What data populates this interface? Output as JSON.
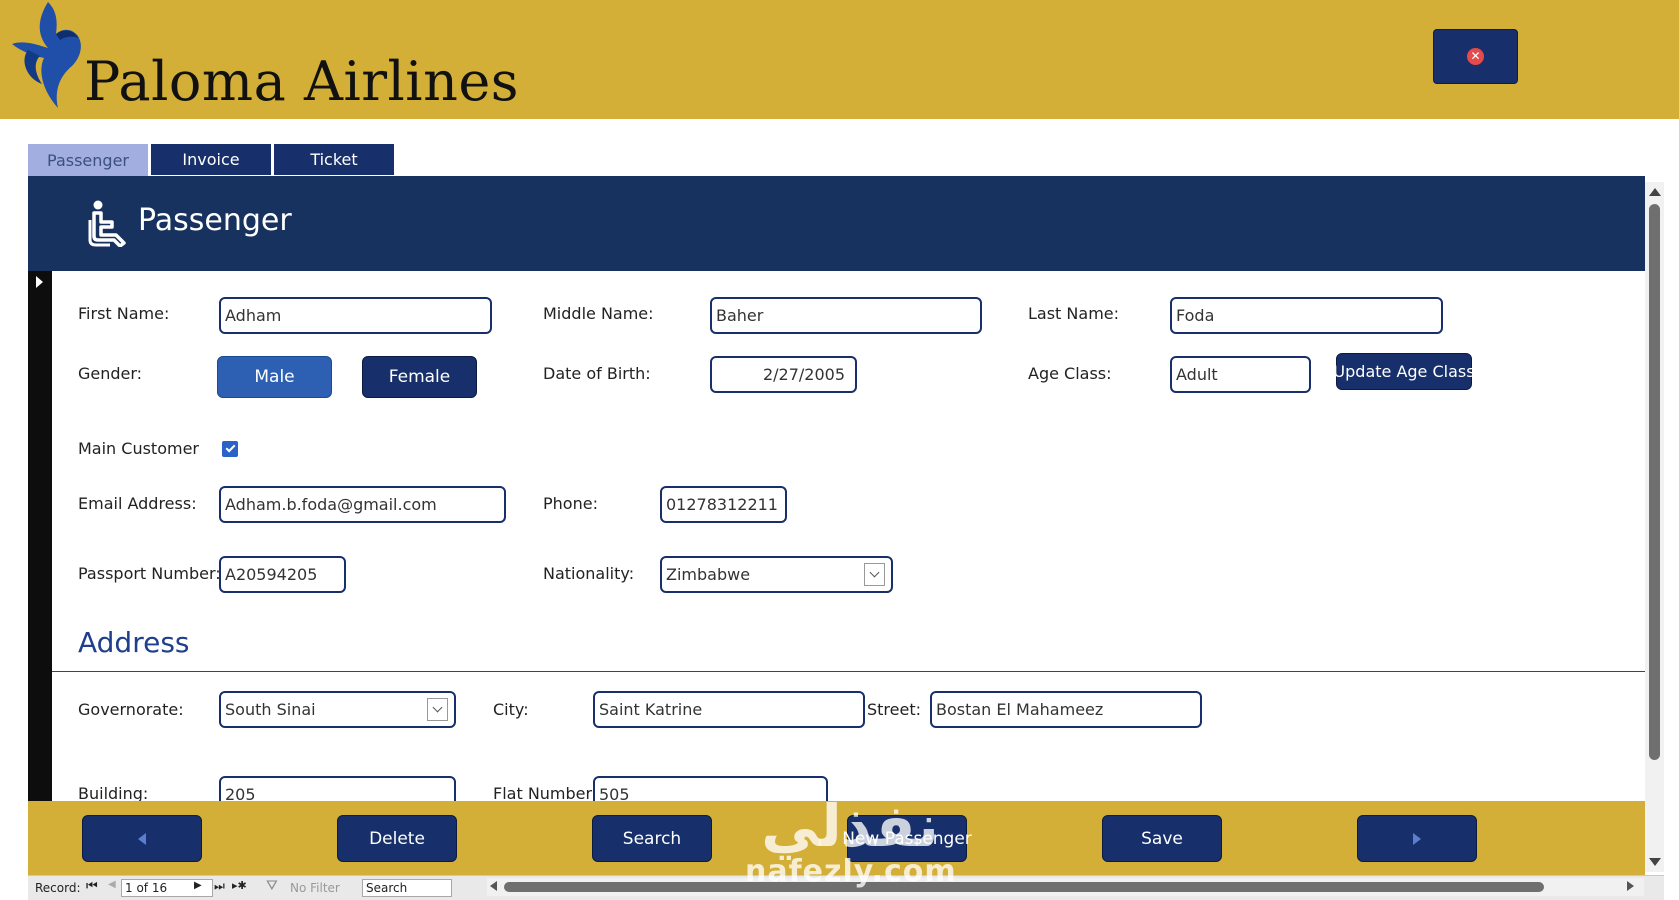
{
  "header": {
    "brand": "Paloma Airlines",
    "close_icon": "close-icon"
  },
  "tabs": [
    {
      "label": "Passenger",
      "active": true
    },
    {
      "label": "Invoice",
      "active": false
    },
    {
      "label": "Ticket",
      "active": false
    }
  ],
  "form": {
    "title": "Passenger",
    "title_icon": "seated-person-icon",
    "labels": {
      "first_name": "First Name:",
      "middle_name": "Middle Name:",
      "last_name": "Last Name:",
      "gender": "Gender:",
      "dob": "Date of Birth:",
      "age_class": "Age Class:",
      "main_customer": "Main Customer",
      "email": "Email Address:",
      "phone": "Phone:",
      "passport": "Passport Number:",
      "nationality": "Nationality:"
    },
    "values": {
      "first_name": "Adham",
      "middle_name": "Baher",
      "last_name": "Foda",
      "dob": "2/27/2005",
      "age_class": "Adult",
      "main_customer_checked": true,
      "email": "Adham.b.foda@gmail.com",
      "phone": "01278312211",
      "passport": "A20594205",
      "nationality": "Zimbabwe"
    },
    "buttons": {
      "male": "Male",
      "female": "Female",
      "update_age_class": "Update Age Class"
    }
  },
  "address": {
    "title": "Address",
    "labels": {
      "governorate": "Governorate:",
      "city": "City:",
      "street": "Street:",
      "building": "Building:",
      "flat": "Flat Number:"
    },
    "values": {
      "governorate": "South Sinai",
      "city": "Saint Katrine",
      "street": "Bostan El Mahameez",
      "building": "205",
      "flat": "505"
    }
  },
  "footer": {
    "prev_icon": "previous-icon",
    "delete": "Delete",
    "search": "Search",
    "new_passenger": "New Passenger",
    "save": "Save",
    "next_icon": "next-icon"
  },
  "record_bar": {
    "record_label": "Record:",
    "position": "1 of 16",
    "no_filter": "No Filter",
    "search": "Search"
  },
  "watermark": {
    "arabic": "نفذلي",
    "latin": "nafezly.com"
  },
  "colors": {
    "gold": "#d4af37",
    "navy": "#17306b",
    "title_band": "#17325f",
    "active_tab": "#a3aee0",
    "male_button": "#2d5fb3"
  }
}
